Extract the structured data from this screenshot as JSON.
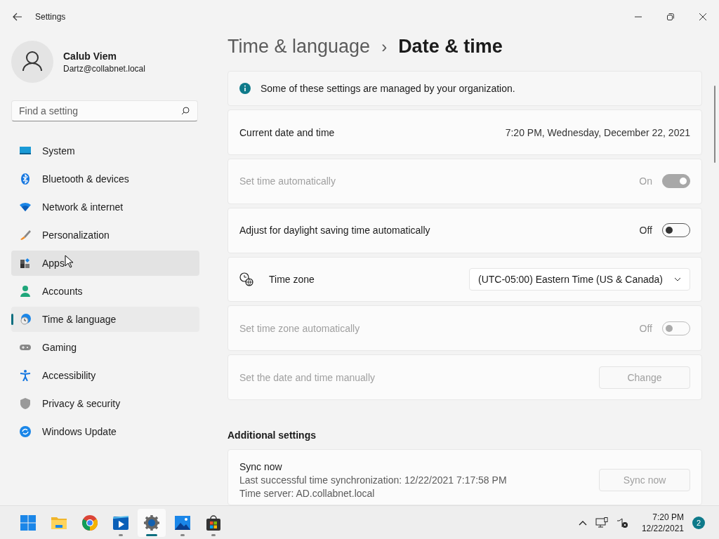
{
  "window": {
    "title": "Settings"
  },
  "user": {
    "name": "Calub Viem",
    "email": "Dartz@collabnet.local"
  },
  "search": {
    "placeholder": "Find a setting"
  },
  "sidebar": {
    "items": [
      {
        "label": "System",
        "selected": false,
        "hovered": false
      },
      {
        "label": "Bluetooth & devices",
        "selected": false,
        "hovered": false
      },
      {
        "label": "Network & internet",
        "selected": false,
        "hovered": false
      },
      {
        "label": "Personalization",
        "selected": false,
        "hovered": false
      },
      {
        "label": "Apps",
        "selected": false,
        "hovered": true
      },
      {
        "label": "Accounts",
        "selected": false,
        "hovered": false
      },
      {
        "label": "Time & language",
        "selected": true,
        "hovered": false
      },
      {
        "label": "Gaming",
        "selected": false,
        "hovered": false
      },
      {
        "label": "Accessibility",
        "selected": false,
        "hovered": false
      },
      {
        "label": "Privacy & security",
        "selected": false,
        "hovered": false
      },
      {
        "label": "Windows Update",
        "selected": false,
        "hovered": false
      }
    ]
  },
  "breadcrumb": {
    "parent": "Time & language",
    "separator": "›",
    "current": "Date & time"
  },
  "notice": "Some of these settings are managed by your organization.",
  "rows": [
    {
      "kind": "value",
      "label": "Current date and time",
      "disabled": false,
      "value": "7:20 PM, Wednesday, December 22, 2021"
    },
    {
      "kind": "toggle",
      "label": "Set time automatically",
      "disabled": true,
      "on": true,
      "state_label": "On"
    },
    {
      "kind": "toggle",
      "label": "Adjust for daylight saving time automatically",
      "disabled": false,
      "on": false,
      "state_label": "Off"
    },
    {
      "kind": "dropdown",
      "label": "Time zone",
      "disabled": false,
      "value": "(UTC-05:00) Eastern Time (US & Canada)"
    },
    {
      "kind": "toggle",
      "label": "Set time zone automatically",
      "disabled": true,
      "on": false,
      "state_label": "Off"
    },
    {
      "kind": "button",
      "label": "Set the date and time manually",
      "disabled": true,
      "button": "Change"
    }
  ],
  "additional": {
    "heading": "Additional settings",
    "sync": {
      "title": "Sync now",
      "lines": [
        "Last successful time synchronization: 12/22/2021 7:17:58 PM",
        "Time server: AD.collabnet.local"
      ],
      "button": "Sync now",
      "disabled": true
    }
  },
  "taskbar": {
    "apps": [
      {
        "running": false,
        "selected": false
      },
      {
        "running": false,
        "selected": false
      },
      {
        "running": false,
        "selected": false
      },
      {
        "running": true,
        "selected": false
      },
      {
        "running": true,
        "selected": true
      },
      {
        "running": true,
        "selected": false
      },
      {
        "running": true,
        "selected": false
      }
    ],
    "time": "7:20 PM",
    "date": "12/22/2021",
    "notifications": "2"
  }
}
